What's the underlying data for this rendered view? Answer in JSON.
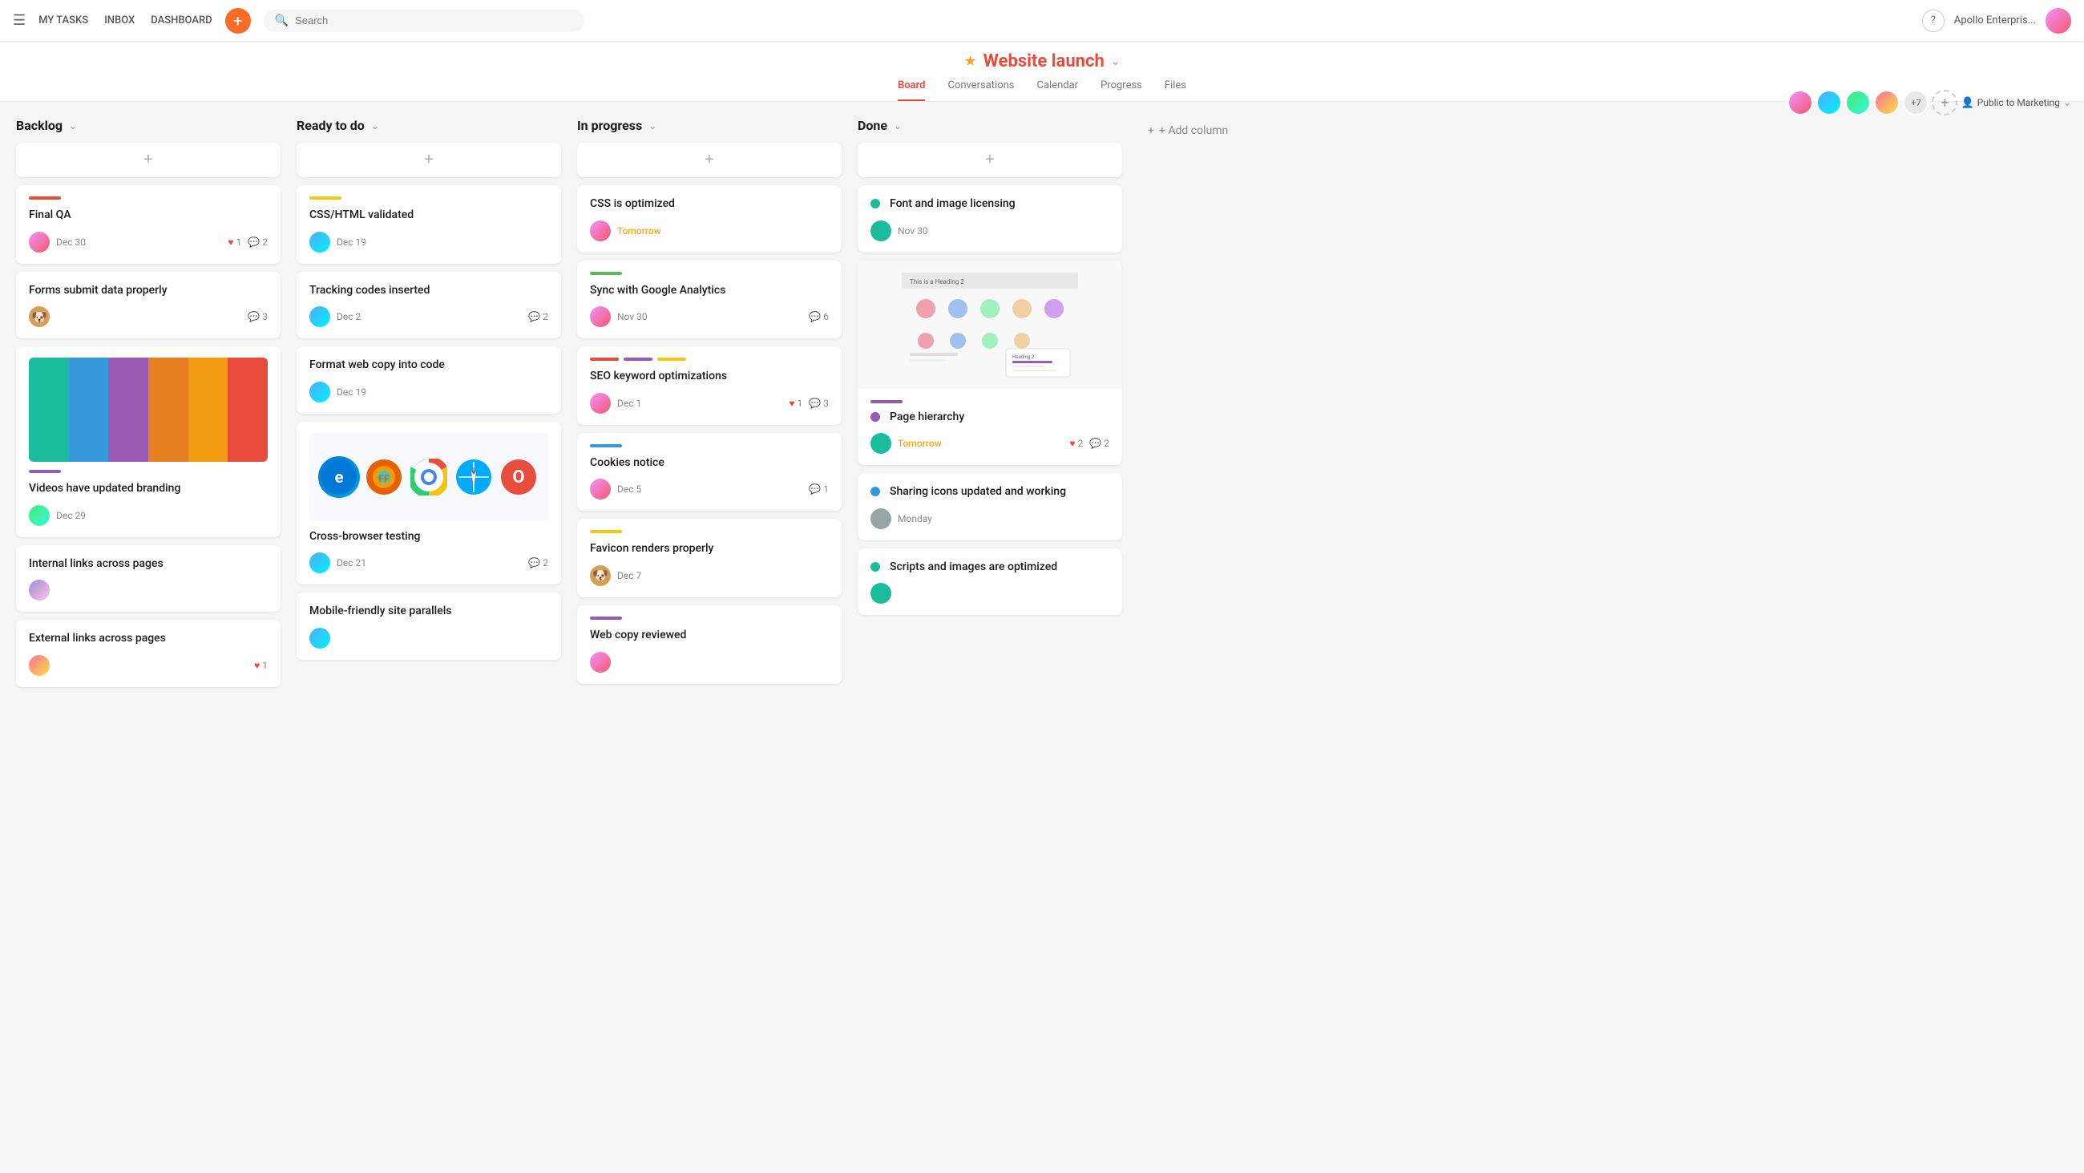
{
  "nav": {
    "hamburger": "☰",
    "links": [
      "MY TASKS",
      "INBOX",
      "DASHBOARD"
    ],
    "add_label": "+",
    "search_placeholder": "Search",
    "help": "?",
    "user_name": "Apollo Enterpris...",
    "team_count": "+7"
  },
  "project": {
    "star": "★",
    "title": "Website launch",
    "dropdown": "⌄",
    "tabs": [
      "Board",
      "Conversations",
      "Calendar",
      "Progress",
      "Files"
    ],
    "active_tab": "Board",
    "visibility": "Public to Marketing",
    "add_column": "+ Add column"
  },
  "columns": {
    "backlog": {
      "title": "Backlog",
      "cards": [
        {
          "id": "final-qa",
          "tag_color": "bar-red",
          "title": "Final QA",
          "date": "Dec 30",
          "avatar": "av-pink",
          "likes": null,
          "comments": null,
          "has_like": false,
          "comment_count": null
        },
        {
          "id": "forms-submit",
          "tag_color": null,
          "title": "Forms submit data properly",
          "date": null,
          "avatar": "av-dog",
          "likes": null,
          "comments": "3",
          "has_like": false,
          "comment_count": "3"
        },
        {
          "id": "videos-branding",
          "tag_color": "bar-purple",
          "title": "Videos have updated branding",
          "date": "Dec 29",
          "avatar": "av-green",
          "likes": null,
          "comments": null,
          "has_like": false,
          "comment_count": null,
          "has_gradient": true
        },
        {
          "id": "internal-links",
          "tag_color": null,
          "title": "Internal links across pages",
          "date": null,
          "avatar": "av-purple",
          "likes": null,
          "comments": null,
          "has_like": false,
          "comment_count": null
        },
        {
          "id": "external-links",
          "tag_color": null,
          "title": "External links across pages",
          "date": null,
          "avatar": "av-orange",
          "likes": null,
          "comments": null,
          "has_like": true,
          "like_count": "1"
        }
      ]
    },
    "ready": {
      "title": "Ready to do",
      "cards": [
        {
          "id": "css-html",
          "tag_color": "bar-yellow",
          "title": "CSS/HTML validated",
          "date": "Dec 19",
          "avatar": "av-blue"
        },
        {
          "id": "tracking-codes",
          "tag_color": null,
          "title": "Tracking codes inserted",
          "date": "Dec 2",
          "avatar": "av-blue",
          "comments": "2"
        },
        {
          "id": "format-web-copy",
          "tag_color": null,
          "title": "Format web copy into code",
          "date": "Dec 19",
          "avatar": "av-blue"
        },
        {
          "id": "cross-browser",
          "tag_color": null,
          "title": "Cross-browser testing",
          "date": "Dec 21",
          "avatar": "av-blue",
          "comments": "2",
          "has_browsers": true
        },
        {
          "id": "mobile-friendly",
          "tag_color": null,
          "title": "Mobile-friendly site parallels",
          "date": null,
          "avatar": "av-blue"
        }
      ]
    },
    "in_progress": {
      "title": "In progress",
      "cards": [
        {
          "id": "css-optimized",
          "tag_color": null,
          "title": "CSS is optimized",
          "date": "Tomorrow",
          "date_class": "tomorrow",
          "avatar": "av-pink"
        },
        {
          "id": "sync-analytics",
          "tag_color": "bar-green",
          "title": "Sync with Google Analytics",
          "date": "Nov 30",
          "avatar": "av-pink",
          "comments": "6"
        },
        {
          "id": "seo-keywords",
          "tag_color": "bar-red bar-purple bar-yellow",
          "title": "SEO keyword optimizations",
          "date": "Dec 1",
          "avatar": "av-pink",
          "likes": "1",
          "comments": "3"
        },
        {
          "id": "cookies-notice",
          "tag_color": "bar-blue",
          "title": "Cookies notice",
          "date": "Dec 5",
          "avatar": "av-pink",
          "comments": "1"
        },
        {
          "id": "favicon",
          "tag_color": "bar-yellow",
          "title": "Favicon renders properly",
          "date": "Dec 7",
          "avatar": "av-dog"
        },
        {
          "id": "web-copy-reviewed",
          "tag_color": "bar-purple",
          "title": "Web copy reviewed",
          "date": null,
          "avatar": "av-pink"
        }
      ]
    },
    "done": {
      "title": "Done",
      "cards": [
        {
          "id": "font-licensing",
          "tag_color": "bar-teal",
          "title": "Font and image licensing",
          "date": "Nov 30",
          "avatar": "av-teal",
          "circle_color": "#1abc9c"
        },
        {
          "id": "page-hierarchy",
          "tag_color": "bar-purple",
          "title": "Page hierarchy",
          "date": "Tomorrow",
          "date_class": "tomorrow",
          "avatar": "av-teal",
          "likes": "2",
          "comments": "2",
          "circle_color": "#9b59b6",
          "has_thumbnail": true
        },
        {
          "id": "sharing-icons",
          "tag_color": null,
          "title": "Sharing icons updated and working",
          "date": "Monday",
          "avatar": "av-gray",
          "circle_color": "#3498db"
        },
        {
          "id": "scripts-images",
          "tag_color": null,
          "title": "Scripts and images are optimized",
          "date": null,
          "avatar": "av-teal",
          "circle_color": "#1abc9c"
        }
      ]
    }
  }
}
